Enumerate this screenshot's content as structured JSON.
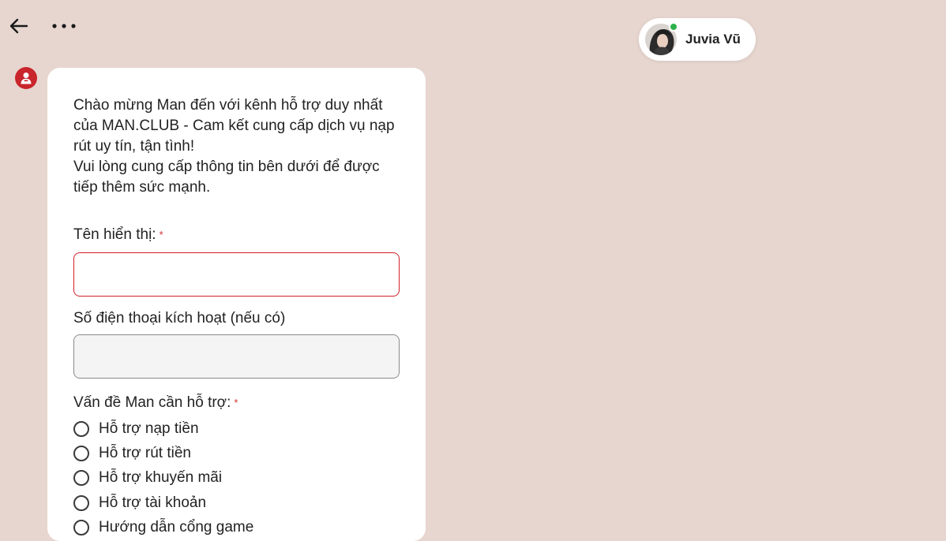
{
  "topbar": {
    "back_icon": "arrow-left-icon",
    "more_icon": "more-horizontal-icon"
  },
  "agent": {
    "name": "Juvia Vũ",
    "online": true,
    "status_color": "#2db24a"
  },
  "bot": {
    "icon": "user-icon",
    "color": "#c9252c"
  },
  "form": {
    "intro_line1": "Chào mừng Man đến với kênh hỗ trợ duy nhất của MAN.CLUB - Cam kết cung cấp dịch vụ nạp rút uy tín, tận tình!",
    "intro_line2": "Vui lòng cung cấp thông tin bên dưới để được tiếp thêm sức mạnh.",
    "display_name_label": "Tên hiển thị:",
    "display_name_value": "",
    "phone_label": "Số điện thoại kích hoạt (nếu có)",
    "phone_value": "",
    "issue_label": "Vấn đề Man cần hỗ trợ:",
    "required_mark": "*",
    "issue_options": [
      "Hỗ trợ nạp tiền",
      "Hỗ trợ rút tiền",
      "Hỗ trợ khuyến mãi",
      "Hỗ trợ tài khoản",
      "Hướng dẫn cổng game"
    ]
  },
  "colors": {
    "background": "#e7d6cf",
    "required": "#d32f2f",
    "error_border": "#d11f2a"
  }
}
